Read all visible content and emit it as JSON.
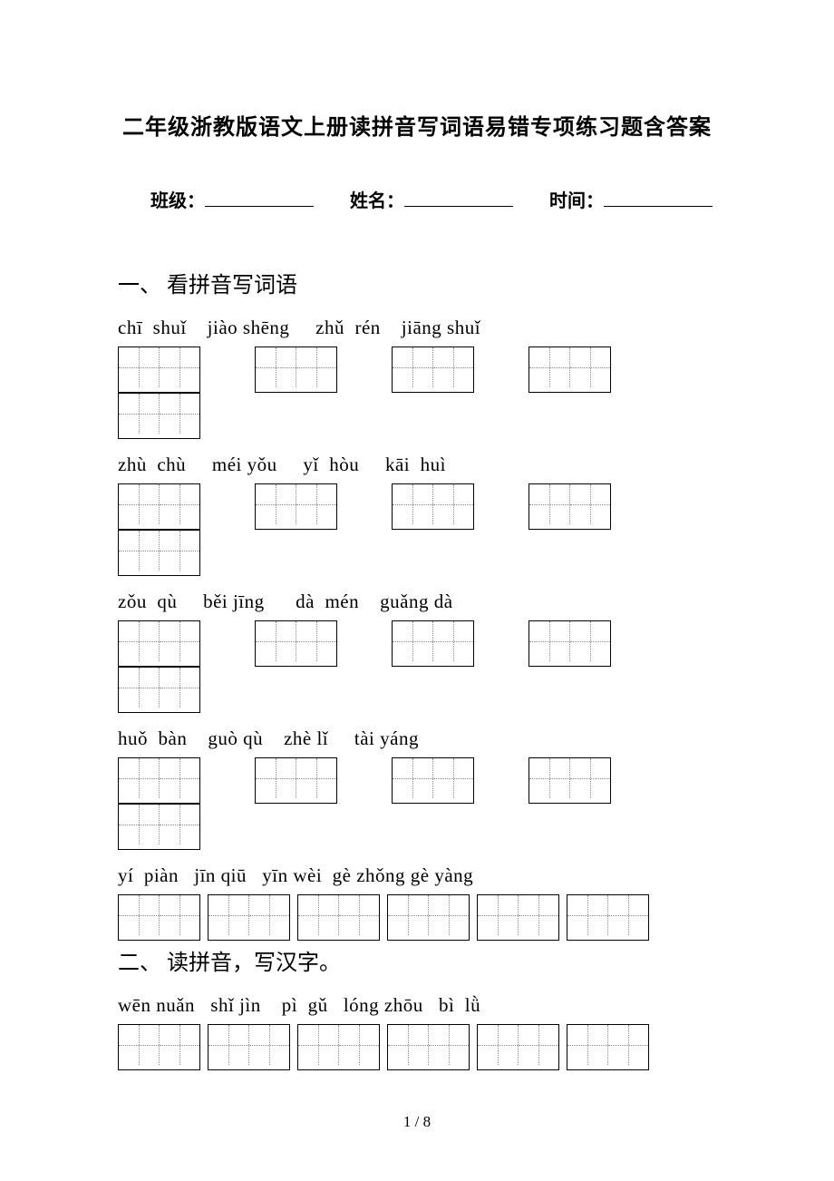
{
  "title": "二年级浙教版语文上册读拼音写词语易错专项练习题含答案",
  "meta": {
    "class_label": "班级：",
    "name_label": "姓名：",
    "time_label": "时间："
  },
  "sections": [
    {
      "number": "一、",
      "heading": "看拼音写词语",
      "rows": [
        {
          "pinyin": "chī  shuǐ    jiào shēng     zhǔ  rén    jiāng shuǐ",
          "groups": [
            2,
            2,
            2,
            2,
            2
          ],
          "class": "row-a"
        },
        {
          "pinyin": "zhù  chù     méi yǒu     yǐ  hòu     kāi  huì",
          "groups": [
            2,
            2,
            2,
            2,
            2
          ],
          "class": "row-a"
        },
        {
          "pinyin": "zǒu  qù     běi jīng      dà  mén    guǎng dà",
          "groups": [
            2,
            2,
            2,
            2,
            2
          ],
          "class": "row-a"
        },
        {
          "pinyin": "huǒ  bàn    guò qù    zhè lǐ     tài yáng",
          "groups": [
            2,
            2,
            2,
            2,
            2
          ],
          "class": "row-a"
        },
        {
          "pinyin": "yí  piàn   jīn qiū   yīn wèi  gè zhǒng gè yàng",
          "groups": [
            2,
            2,
            2,
            2,
            2,
            2
          ],
          "class": "row-b"
        }
      ]
    },
    {
      "number": "二、",
      "heading": "读拼音，写汉字。",
      "rows": [
        {
          "pinyin": "wēn nuǎn   shǐ jìn    pì  gǔ   lóng zhōu   bì  lǜ",
          "groups": [
            2,
            2,
            2,
            2,
            2,
            2
          ],
          "class": "row-b"
        }
      ]
    }
  ],
  "footer": "1 / 8"
}
